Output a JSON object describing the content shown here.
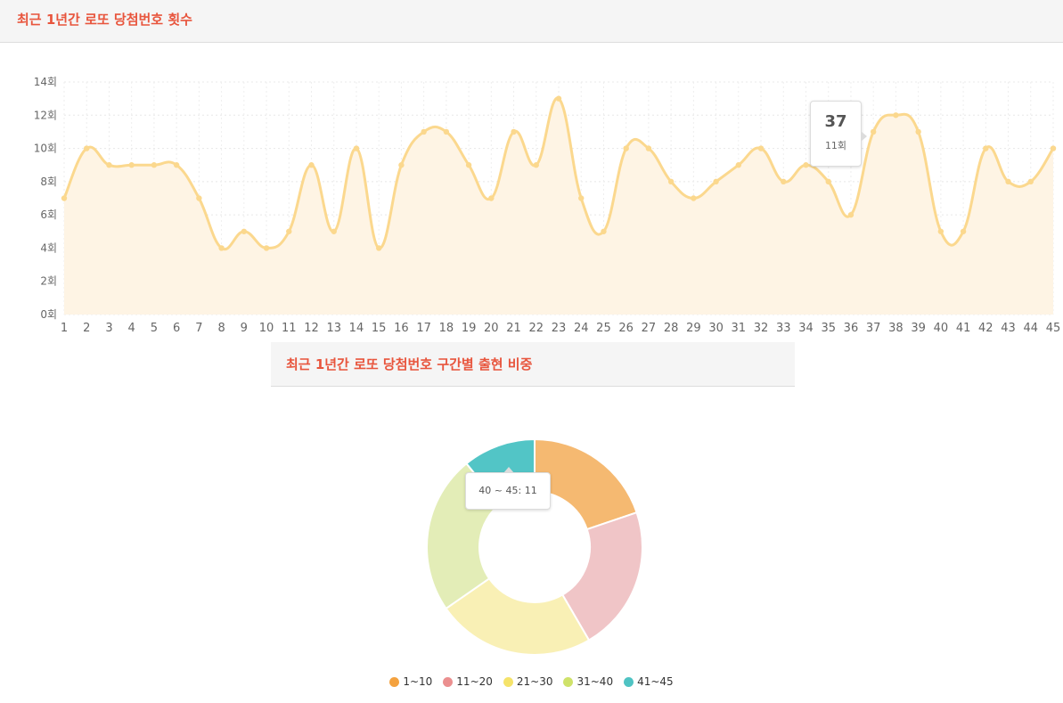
{
  "header1": {
    "title": "최근 1년간 로또 당첨번호 횟수"
  },
  "header2": {
    "title": "최근 1년간 로또 당첨번호 구간별 출현 비중"
  },
  "colors": {
    "line": "#fbd88e",
    "area": "#fef4e4",
    "title": "#e8553d"
  },
  "tooltip_line": {
    "value": "37",
    "label": "11회"
  },
  "tooltip_donut": {
    "text": "40 ~ 45: 11"
  },
  "chart_data": [
    {
      "type": "line",
      "x": [
        1,
        2,
        3,
        4,
        5,
        6,
        7,
        8,
        9,
        10,
        11,
        12,
        13,
        14,
        15,
        16,
        17,
        18,
        19,
        20,
        21,
        22,
        23,
        24,
        25,
        26,
        27,
        28,
        29,
        30,
        31,
        32,
        33,
        34,
        35,
        36,
        37,
        38,
        39,
        40,
        41,
        42,
        43,
        44,
        45
      ],
      "values": [
        7,
        10,
        9,
        9,
        9,
        9,
        7,
        4,
        5,
        4,
        5,
        9,
        5,
        10,
        4,
        9,
        11,
        11,
        9,
        7,
        11,
        9,
        13,
        7,
        5,
        10,
        10,
        8,
        7,
        8,
        9,
        10,
        8,
        9,
        8,
        6,
        11,
        12,
        11,
        5,
        5,
        10,
        8,
        8,
        10
      ],
      "y_ticks": [
        "0회",
        "2회",
        "4회",
        "6회",
        "8회",
        "10회",
        "12회",
        "14회"
      ],
      "ylim": [
        0,
        14
      ],
      "grid": true
    },
    {
      "type": "pie",
      "labels": [
        "1~10",
        "11~20",
        "21~30",
        "31~40",
        "41~45"
      ],
      "values": [
        20,
        22,
        24,
        24,
        11
      ],
      "colors": [
        "#f5b971",
        "#f0c5c7",
        "#f9f0b5",
        "#e3edb7",
        "#52c5c6"
      ],
      "legend_colors": [
        "#f4a23f",
        "#eb8f8f",
        "#f5e36a",
        "#cfe26a",
        "#4fc3c3"
      ],
      "legend_position": "bottom"
    }
  ]
}
